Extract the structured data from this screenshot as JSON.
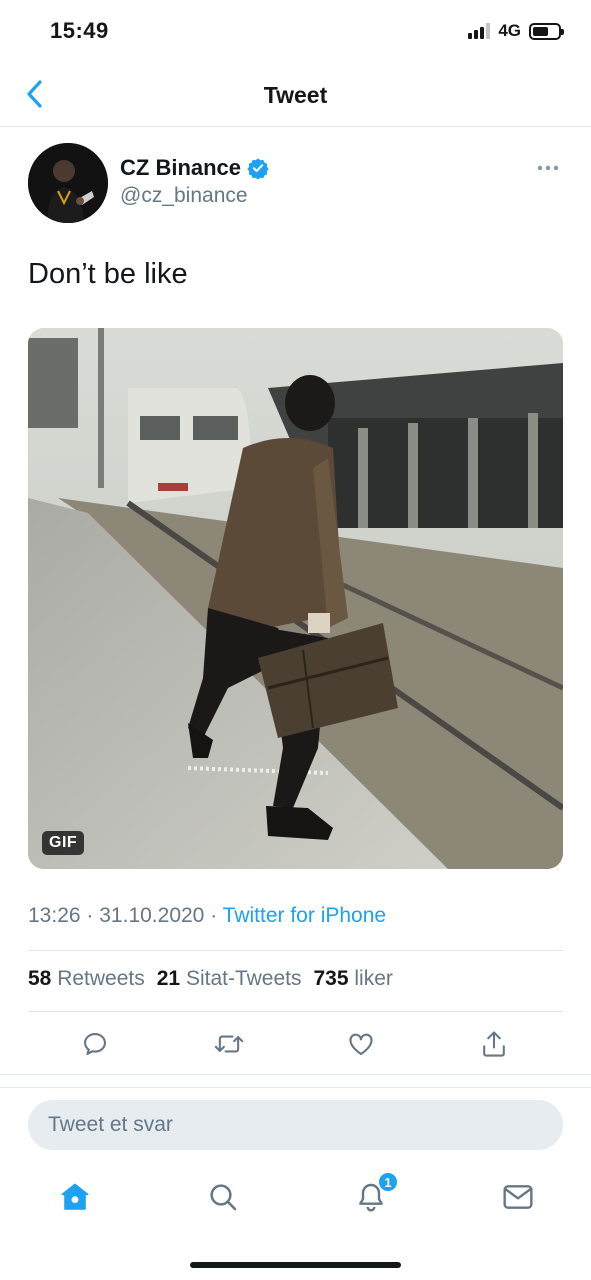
{
  "status_bar": {
    "time": "15:49",
    "network": "4G"
  },
  "nav": {
    "title": "Tweet",
    "back_icon": "chevron-left-icon"
  },
  "tweet": {
    "author_name": "CZ Binance",
    "author_handle": "@cz_binance",
    "verified": true,
    "text": "Don’t be like",
    "media_badge": "GIF",
    "time": "13:26",
    "date": "31.10.2020",
    "source": "Twitter for iPhone",
    "separator": "·"
  },
  "stats": [
    {
      "count": "58",
      "label": "Retweets"
    },
    {
      "count": "21",
      "label": "Sitat-Tweets"
    },
    {
      "count": "735",
      "label": "liker"
    }
  ],
  "actions": [
    "reply-icon",
    "retweet-icon",
    "like-icon",
    "share-icon"
  ],
  "reply": {
    "placeholder": "Tweet et svar"
  },
  "tabbar": {
    "items": [
      "home-icon",
      "search-icon",
      "notifications-icon",
      "messages-icon"
    ],
    "notification_count": "1"
  },
  "colors": {
    "accent": "#1da1f2",
    "text": "#14171a",
    "secondary_text": "#657786",
    "divider": "#e1e8ed"
  }
}
